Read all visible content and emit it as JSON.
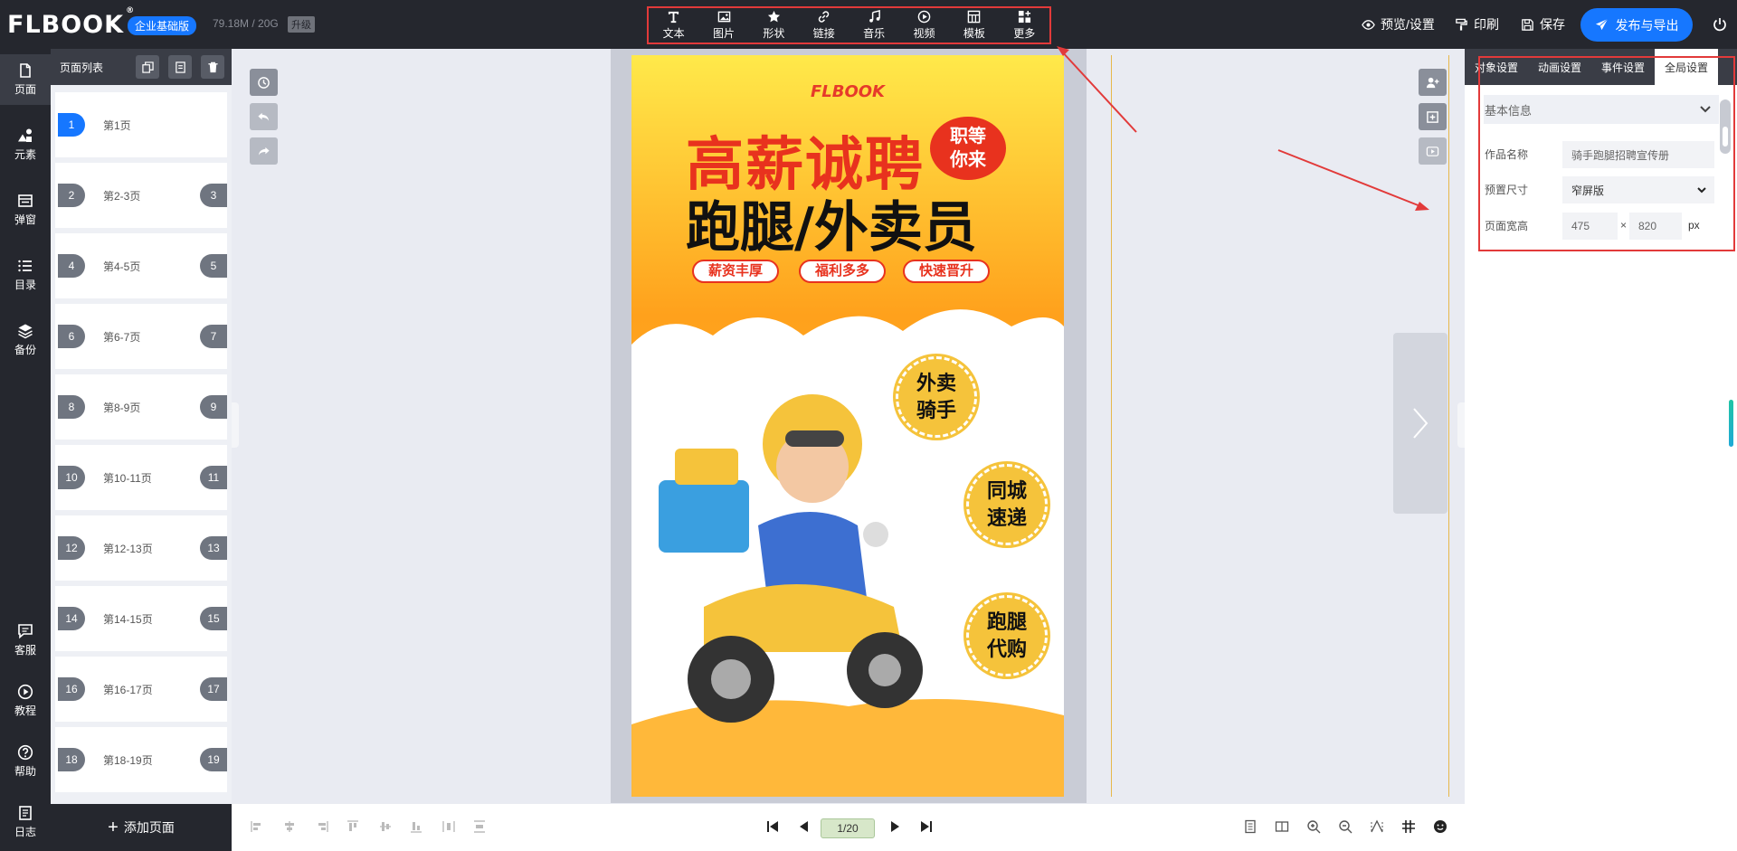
{
  "header": {
    "logo": "FLBOOK",
    "logo_mark": "®",
    "edition": "企业基础版",
    "storage": "79.18M / 20G",
    "upgrade": "升级",
    "tools": [
      {
        "label": "文本",
        "icon": "text-icon"
      },
      {
        "label": "图片",
        "icon": "image-icon"
      },
      {
        "label": "形状",
        "icon": "star-icon"
      },
      {
        "label": "链接",
        "icon": "link-icon"
      },
      {
        "label": "音乐",
        "icon": "music-icon"
      },
      {
        "label": "视频",
        "icon": "video-icon"
      },
      {
        "label": "模板",
        "icon": "template-icon"
      },
      {
        "label": "更多",
        "icon": "more-icon"
      }
    ],
    "preview": "预览/设置",
    "print": "印刷",
    "save": "保存",
    "publish": "发布与导出"
  },
  "rail": [
    {
      "label": "页面",
      "icon": "page-icon"
    },
    {
      "label": "元素",
      "icon": "elements-icon"
    },
    {
      "label": "弹窗",
      "icon": "popup-icon"
    },
    {
      "label": "目录",
      "icon": "toc-icon"
    },
    {
      "label": "备份",
      "icon": "backup-icon"
    },
    {
      "label": "客服",
      "icon": "chat-icon"
    },
    {
      "label": "教程",
      "icon": "play-icon"
    },
    {
      "label": "帮助",
      "icon": "help-icon"
    },
    {
      "label": "日志",
      "icon": "log-icon"
    }
  ],
  "page_list": {
    "title": "页面列表",
    "pages": [
      {
        "left": "1",
        "label": "第1页",
        "right": ""
      },
      {
        "left": "2",
        "label": "第2-3页",
        "right": "3"
      },
      {
        "left": "4",
        "label": "第4-5页",
        "right": "5"
      },
      {
        "left": "6",
        "label": "第6-7页",
        "right": "7"
      },
      {
        "left": "8",
        "label": "第8-9页",
        "right": "9"
      },
      {
        "left": "10",
        "label": "第10-11页",
        "right": "11"
      },
      {
        "left": "12",
        "label": "第12-13页",
        "right": "13"
      },
      {
        "left": "14",
        "label": "第14-15页",
        "right": "15"
      },
      {
        "left": "16",
        "label": "第16-17页",
        "right": "17"
      },
      {
        "left": "18",
        "label": "第18-19页",
        "right": "19"
      }
    ],
    "add_page": "添加页面"
  },
  "poster": {
    "brand": "FLBOOK",
    "headline": "高薪诚聘",
    "bubble": "职等\n你来",
    "subhead": "跑腿/外卖员",
    "pills": [
      "薪资丰厚",
      "福利多多",
      "快速晋升"
    ],
    "badges": [
      [
        "外卖",
        "骑手"
      ],
      [
        "同城",
        "速递"
      ],
      [
        "跑腿",
        "代购"
      ]
    ]
  },
  "pager": {
    "current": "1/20"
  },
  "panel": {
    "tabs": [
      "对象设置",
      "动画设置",
      "事件设置",
      "全局设置"
    ],
    "active_tab": 3,
    "section": "基本信息",
    "name_label": "作品名称",
    "name_value": "骑手跑腿招聘宣传册",
    "size_label": "预置尺寸",
    "size_value": "窄屏版",
    "wh_label": "页面宽高",
    "width": "475",
    "times": "×",
    "height": "820",
    "unit": "px"
  },
  "colors": {
    "accent": "#1677ff",
    "dark": "#25272e",
    "highlight": "#e23a3a"
  }
}
